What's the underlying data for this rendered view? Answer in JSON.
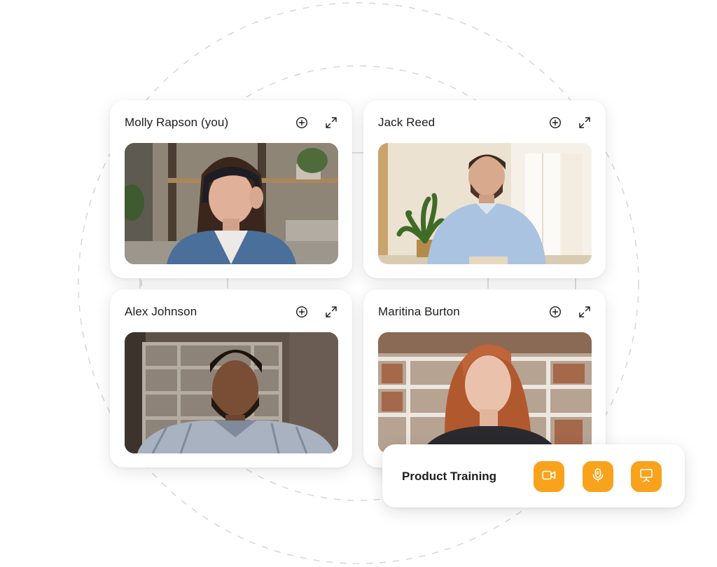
{
  "participants": [
    {
      "name": "Molly Rapson (you)"
    },
    {
      "name": "Jack Reed"
    },
    {
      "name": "Alex Johnson"
    },
    {
      "name": "Maritina Burton"
    }
  ],
  "toolbar": {
    "title": "Product Training",
    "controls": [
      "video-camera-icon",
      "microphone-icon",
      "screen-share-icon"
    ]
  },
  "colors": {
    "accent": "#f9a21b",
    "ring": "#d6d6d6"
  }
}
